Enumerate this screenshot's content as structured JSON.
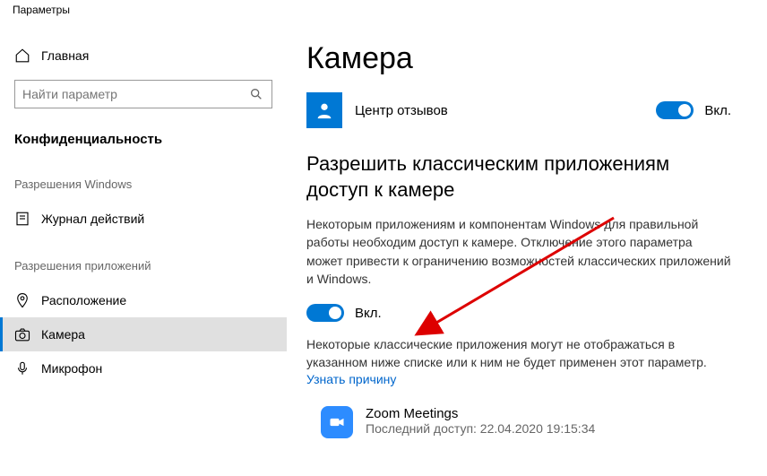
{
  "window": {
    "title": "Параметры"
  },
  "sidebar": {
    "home": "Главная",
    "search_placeholder": "Найти параметр",
    "privacy": "Конфиденциальность",
    "group_windows": "Разрешения Windows",
    "activity": "Журнал действий",
    "group_apps": "Разрешения приложений",
    "location": "Расположение",
    "camera": "Камера",
    "microphone": "Микрофон"
  },
  "main": {
    "title": "Камера",
    "app1_name": "Центр отзывов",
    "toggle_on": "Вкл.",
    "classic_heading": "Разрешить классическим приложениям доступ к камере",
    "classic_desc": "Некоторым приложениям и компонентам Windows для правильной работы необходим доступ к камере. Отключение этого параметра может привести к ограничению возможностей классических приложений и Windows.",
    "classic_note": "Некоторые классические приложения могут не отображаться в указанном ниже списке или к ним не будет применен этот параметр.",
    "learn_more": "Узнать причину",
    "zoom_name": "Zoom Meetings",
    "zoom_last": "Последний доступ: 22.04.2020 19:15:34"
  }
}
